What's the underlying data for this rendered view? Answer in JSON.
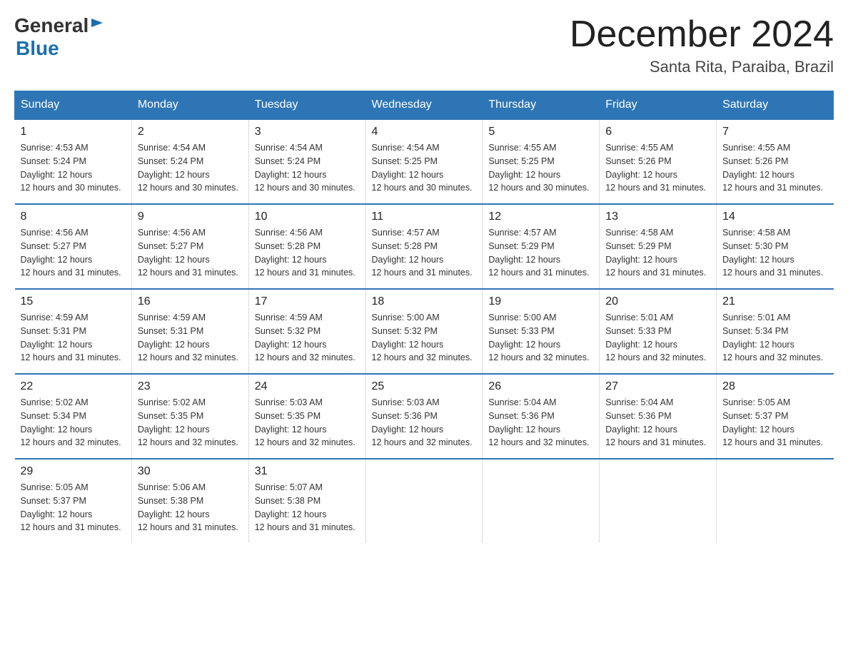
{
  "header": {
    "logo_general": "General",
    "logo_blue": "Blue",
    "month_title": "December 2024",
    "subtitle": "Santa Rita, Paraiba, Brazil"
  },
  "days_of_week": [
    "Sunday",
    "Monday",
    "Tuesday",
    "Wednesday",
    "Thursday",
    "Friday",
    "Saturday"
  ],
  "weeks": [
    [
      {
        "num": "1",
        "sunrise": "4:53 AM",
        "sunset": "5:24 PM",
        "daylight": "12 hours and 30 minutes."
      },
      {
        "num": "2",
        "sunrise": "4:54 AM",
        "sunset": "5:24 PM",
        "daylight": "12 hours and 30 minutes."
      },
      {
        "num": "3",
        "sunrise": "4:54 AM",
        "sunset": "5:24 PM",
        "daylight": "12 hours and 30 minutes."
      },
      {
        "num": "4",
        "sunrise": "4:54 AM",
        "sunset": "5:25 PM",
        "daylight": "12 hours and 30 minutes."
      },
      {
        "num": "5",
        "sunrise": "4:55 AM",
        "sunset": "5:25 PM",
        "daylight": "12 hours and 30 minutes."
      },
      {
        "num": "6",
        "sunrise": "4:55 AM",
        "sunset": "5:26 PM",
        "daylight": "12 hours and 31 minutes."
      },
      {
        "num": "7",
        "sunrise": "4:55 AM",
        "sunset": "5:26 PM",
        "daylight": "12 hours and 31 minutes."
      }
    ],
    [
      {
        "num": "8",
        "sunrise": "4:56 AM",
        "sunset": "5:27 PM",
        "daylight": "12 hours and 31 minutes."
      },
      {
        "num": "9",
        "sunrise": "4:56 AM",
        "sunset": "5:27 PM",
        "daylight": "12 hours and 31 minutes."
      },
      {
        "num": "10",
        "sunrise": "4:56 AM",
        "sunset": "5:28 PM",
        "daylight": "12 hours and 31 minutes."
      },
      {
        "num": "11",
        "sunrise": "4:57 AM",
        "sunset": "5:28 PM",
        "daylight": "12 hours and 31 minutes."
      },
      {
        "num": "12",
        "sunrise": "4:57 AM",
        "sunset": "5:29 PM",
        "daylight": "12 hours and 31 minutes."
      },
      {
        "num": "13",
        "sunrise": "4:58 AM",
        "sunset": "5:29 PM",
        "daylight": "12 hours and 31 minutes."
      },
      {
        "num": "14",
        "sunrise": "4:58 AM",
        "sunset": "5:30 PM",
        "daylight": "12 hours and 31 minutes."
      }
    ],
    [
      {
        "num": "15",
        "sunrise": "4:59 AM",
        "sunset": "5:31 PM",
        "daylight": "12 hours and 31 minutes."
      },
      {
        "num": "16",
        "sunrise": "4:59 AM",
        "sunset": "5:31 PM",
        "daylight": "12 hours and 32 minutes."
      },
      {
        "num": "17",
        "sunrise": "4:59 AM",
        "sunset": "5:32 PM",
        "daylight": "12 hours and 32 minutes."
      },
      {
        "num": "18",
        "sunrise": "5:00 AM",
        "sunset": "5:32 PM",
        "daylight": "12 hours and 32 minutes."
      },
      {
        "num": "19",
        "sunrise": "5:00 AM",
        "sunset": "5:33 PM",
        "daylight": "12 hours and 32 minutes."
      },
      {
        "num": "20",
        "sunrise": "5:01 AM",
        "sunset": "5:33 PM",
        "daylight": "12 hours and 32 minutes."
      },
      {
        "num": "21",
        "sunrise": "5:01 AM",
        "sunset": "5:34 PM",
        "daylight": "12 hours and 32 minutes."
      }
    ],
    [
      {
        "num": "22",
        "sunrise": "5:02 AM",
        "sunset": "5:34 PM",
        "daylight": "12 hours and 32 minutes."
      },
      {
        "num": "23",
        "sunrise": "5:02 AM",
        "sunset": "5:35 PM",
        "daylight": "12 hours and 32 minutes."
      },
      {
        "num": "24",
        "sunrise": "5:03 AM",
        "sunset": "5:35 PM",
        "daylight": "12 hours and 32 minutes."
      },
      {
        "num": "25",
        "sunrise": "5:03 AM",
        "sunset": "5:36 PM",
        "daylight": "12 hours and 32 minutes."
      },
      {
        "num": "26",
        "sunrise": "5:04 AM",
        "sunset": "5:36 PM",
        "daylight": "12 hours and 32 minutes."
      },
      {
        "num": "27",
        "sunrise": "5:04 AM",
        "sunset": "5:36 PM",
        "daylight": "12 hours and 31 minutes."
      },
      {
        "num": "28",
        "sunrise": "5:05 AM",
        "sunset": "5:37 PM",
        "daylight": "12 hours and 31 minutes."
      }
    ],
    [
      {
        "num": "29",
        "sunrise": "5:05 AM",
        "sunset": "5:37 PM",
        "daylight": "12 hours and 31 minutes."
      },
      {
        "num": "30",
        "sunrise": "5:06 AM",
        "sunset": "5:38 PM",
        "daylight": "12 hours and 31 minutes."
      },
      {
        "num": "31",
        "sunrise": "5:07 AM",
        "sunset": "5:38 PM",
        "daylight": "12 hours and 31 minutes."
      },
      null,
      null,
      null,
      null
    ]
  ]
}
